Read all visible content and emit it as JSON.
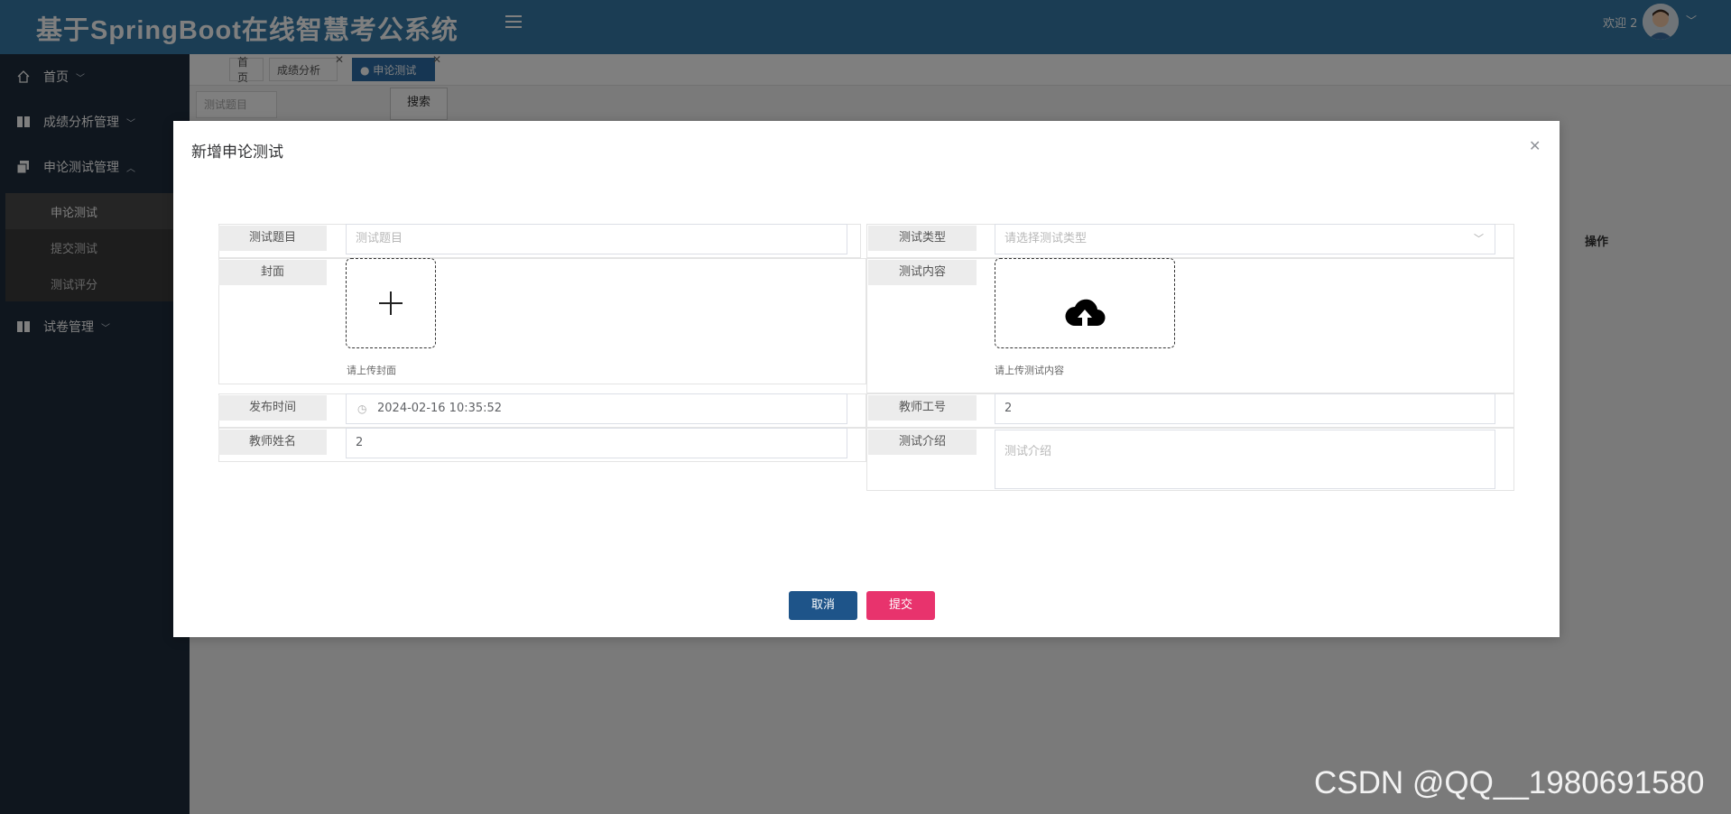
{
  "app": {
    "title": "基于SpringBoot在线智慧考公系统",
    "welcome": "欢迎 2",
    "colors": {
      "header": "#367ba8",
      "sidebar": "#1f2d3d",
      "cancel": "#1e5489",
      "submit": "#e8336d"
    }
  },
  "sidebar": {
    "items": [
      {
        "label": "首页",
        "icon": "home-icon"
      },
      {
        "label": "成绩分析管理",
        "icon": "columns-icon"
      },
      {
        "label": "申论测试管理",
        "icon": "copy-icon",
        "expanded": true
      },
      {
        "label": "试卷管理",
        "icon": "columns-icon"
      }
    ],
    "submenu": [
      {
        "label": "申论测试",
        "active": true
      },
      {
        "label": "提交测试"
      },
      {
        "label": "测试评分"
      }
    ]
  },
  "tabs": [
    {
      "label": "首页"
    },
    {
      "label": "成绩分析",
      "closable": true
    },
    {
      "label": "● 申论测试",
      "closable": true,
      "active": true
    }
  ],
  "search": {
    "placeholder": "测试题目",
    "button": "搜索"
  },
  "table": {
    "op_header": "操作"
  },
  "dialog": {
    "title": "新增申论测试",
    "fields": {
      "title_label": "测试题目",
      "title_placeholder": "测试题目",
      "type_label": "测试类型",
      "type_placeholder": "请选择测试类型",
      "cover_label": "封面",
      "cover_hint": "请上传封面",
      "content_label": "测试内容",
      "content_hint": "请上传测试内容",
      "publish_label": "发布时间",
      "publish_value": "2024-02-16 10:35:52",
      "teacher_no_label": "教师工号",
      "teacher_no_value": "2",
      "teacher_name_label": "教师姓名",
      "teacher_name_value": "2",
      "intro_label": "测试介绍",
      "intro_placeholder": "测试介绍"
    },
    "cancel": "取消",
    "submit": "提交"
  },
  "watermark": "CSDN @QQ__1980691580"
}
